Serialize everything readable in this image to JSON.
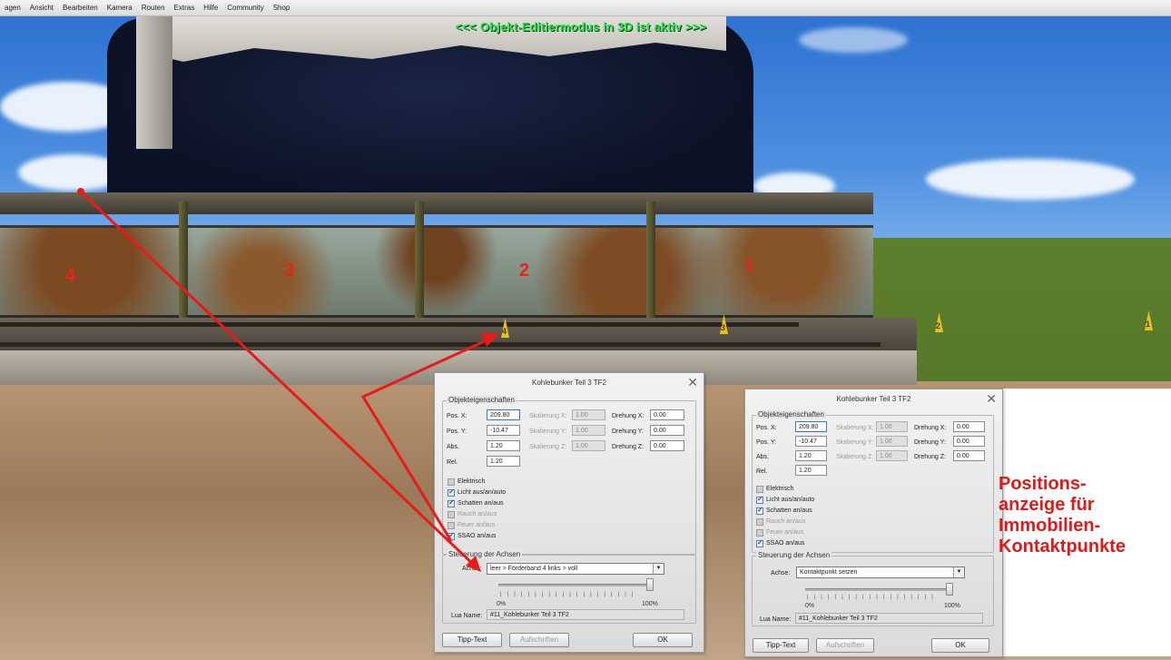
{
  "menu": {
    "items": [
      "agen",
      "Ansicht",
      "Bearbeiten",
      "Kamera",
      "Routen",
      "Extras",
      "Hilfe",
      "Community",
      "Shop"
    ]
  },
  "banner": "<<< Objekt-Editiermodus in 3D ist aktiv >>>",
  "scene": {
    "segment_numbers": [
      "4",
      "3",
      "2",
      "1"
    ],
    "marker_numbers": [
      "4",
      "3",
      "2",
      "1"
    ]
  },
  "dialog_left": {
    "title": "Kohlebunker Teil 3 TF2",
    "group_props": "Objekteigenschaften",
    "pos_x_label": "Pos. X:",
    "pos_x": "209.80",
    "pos_y_label": "Pos. Y:",
    "pos_y": "-10.47",
    "abs_label": "Abs.",
    "abs": "1.20",
    "rel_label": "Rel.",
    "rel": "1.20",
    "skal_x_label": "Skalierung X:",
    "skal_x": "1.00",
    "skal_y_label": "Skalierung Y:",
    "skal_y": "1.00",
    "skal_z_label": "Skalierung Z:",
    "skal_z": "1.00",
    "dreh_x_label": "Drehung X:",
    "dreh_x": "0.00",
    "dreh_y_label": "Drehung Y:",
    "dreh_y": "0.00",
    "dreh_z_label": "Drehung Z:",
    "dreh_z": "0.00",
    "checkboxes": [
      "Elektrisch",
      "Licht aus/an/auto",
      "Schatten an/aus",
      "Rauch an/aus",
      "Feuer an/aus",
      "SSAO an/aus"
    ],
    "group_axes": "Steuerung der Achsen",
    "axes_label": "Achse:",
    "axes_value": "leer > Förderband 4 links > voll",
    "pct_min": "0%",
    "pct_max": "100%",
    "lua_label": "Lua Name:",
    "lua_value": "#11_Kohlebunker Teil 3 TF2",
    "btn_tip": "Tipp-Text",
    "btn_aufschriften": "Aufschriften",
    "btn_ok": "OK"
  },
  "dialog_right": {
    "title": "Kohlebunker Teil 3 TF2",
    "group_props": "Objekteigenschaften",
    "pos_x_label": "Pos. X:",
    "pos_x": "209.80",
    "pos_y_label": "Pos. Y:",
    "pos_y": "-10.47",
    "abs_label": "Abs.",
    "abs": "1.20",
    "rel_label": "Rel.",
    "rel": "1.20",
    "skal_x_label": "Skalierung X:",
    "skal_x": "1.00",
    "skal_y_label": "Skalierung Y:",
    "skal_y": "1.00",
    "skal_z_label": "Skalierung Z:",
    "skal_z": "1.00",
    "dreh_x_label": "Drehung X:",
    "dreh_x": "0.00",
    "dreh_y_label": "Drehung Y:",
    "dreh_y": "0.00",
    "dreh_z_label": "Drehung Z:",
    "dreh_z": "0.00",
    "checkboxes": [
      "Elektrisch",
      "Licht aus/an/auto",
      "Schatten an/aus",
      "Rauch an/aus",
      "Feuer an/aus",
      "SSAO an/aus"
    ],
    "group_axes": "Steuerung der Achsen",
    "axes_label": "Achse:",
    "axes_value": "Kontaktpunkt setzen",
    "pct_min": "0%",
    "pct_max": "100%",
    "lua_label": "Lua Name:",
    "lua_value": "#11_Kohlebunker Teil 3 TF2",
    "btn_tip": "Tipp-Text",
    "btn_aufschriften": "Aufschriften",
    "btn_ok": "OK"
  },
  "note_lines": [
    "Positions-",
    "anzeige für",
    "Immobilien-",
    "Kontaktpunkte"
  ],
  "colors": {
    "banner": "#22e84a",
    "annotation": "#e01a1a"
  }
}
